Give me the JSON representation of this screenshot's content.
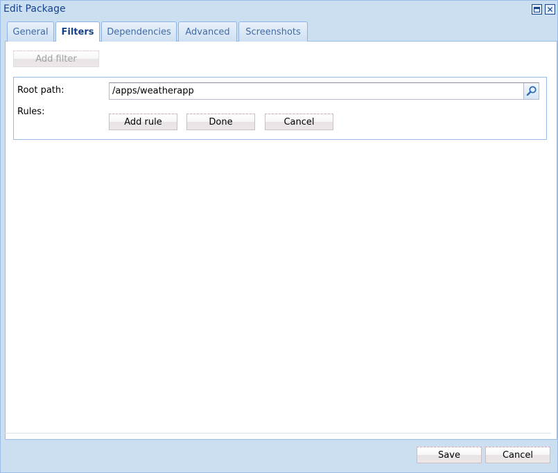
{
  "window": {
    "title": "Edit Package"
  },
  "tabs": [
    {
      "label": "General",
      "active": false
    },
    {
      "label": "Filters",
      "active": true
    },
    {
      "label": "Dependencies",
      "active": false
    },
    {
      "label": "Advanced",
      "active": false
    },
    {
      "label": "Screenshots",
      "active": false
    }
  ],
  "filters": {
    "add_filter_label": "Add filter",
    "root_path_label": "Root path:",
    "root_path_value": "/apps/weatherapp",
    "rules_label": "Rules:",
    "add_rule_label": "Add rule",
    "done_label": "Done",
    "cancel_label": "Cancel"
  },
  "footer": {
    "save_label": "Save",
    "cancel_label": "Cancel"
  },
  "icons": {
    "maximize": "maximize-icon",
    "close": "close-icon",
    "search": "search-icon"
  },
  "colors": {
    "window_bg": "#cbdff1",
    "title_text": "#15428b",
    "border": "#99bbe8"
  }
}
